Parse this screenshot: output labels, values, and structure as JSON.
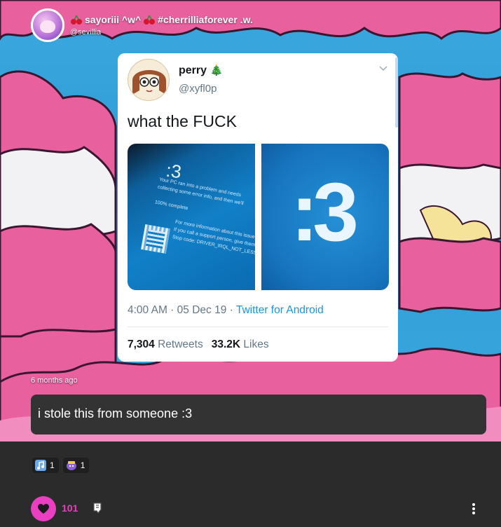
{
  "header": {
    "display_name": "sayoriii ^w^ #cherrilliaforever .w.",
    "display_name_parts": {
      "before": "sayoriii ^w^",
      "after": "#cherrilliaforever .w."
    },
    "handle": "@sevillia",
    "emoji": "cherry-icon"
  },
  "tweet": {
    "name": "perry",
    "name_emoji": "🎄",
    "handle": "@xyfl0p",
    "text": "what the FUCK",
    "left_image": {
      "face": ":3",
      "lines": [
        "Your PC ran into a problem and needs",
        "collecting some error info, and then we'll",
        "",
        "100% complete",
        "",
        "For more information about this issue and possible f",
        "If you call a support person, give them this info:",
        "Stop code: DRIVER_IRQL_NOT_LESS_OR_EQUAL"
      ]
    },
    "right_image": {
      "face": ":3"
    },
    "time": "4:00 AM",
    "date": "05 Dec 19",
    "separator": "·",
    "source": "Twitter for Android",
    "retweets_count": "7,304",
    "retweets_label": "Retweets",
    "likes_count": "33.2K",
    "likes_label": "Likes"
  },
  "post": {
    "timestamp": "6 months ago",
    "caption": "i stole this from someone :3"
  },
  "reactions": [
    {
      "emoji": "music-note-icon",
      "count": "1"
    },
    {
      "emoji": "blob-icon",
      "count": "1"
    }
  ],
  "footer": {
    "like_count": "101",
    "like_icon": "heart-icon",
    "boost_icon": "boost-icon",
    "more_icon": "more-vertical-icon"
  },
  "colors": {
    "sky": "#3ba7dd",
    "cloud_pink": "#e9609f",
    "accent_pink": "#ea3fc0",
    "caption_bg": "#333333",
    "page_bg": "#2b2b2b",
    "tweet_link": "#1b95e0"
  }
}
